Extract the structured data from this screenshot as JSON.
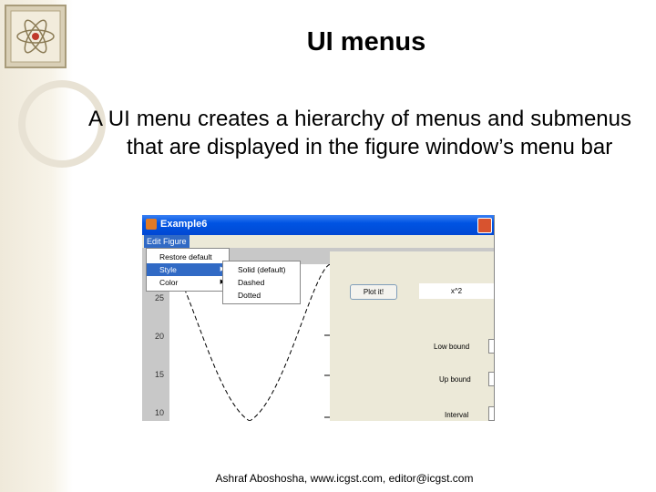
{
  "slide": {
    "title": "UI menus",
    "bullet": "A UI menu creates a hierarchy of menus and submenus that are displayed in the figure window’s menu bar",
    "footer": "Ashraf Aboshosha, www.icgst.com, editor@icgst.com"
  },
  "window": {
    "title": "Example6",
    "menubar": [
      "Edit Figure"
    ],
    "dropdown": [
      {
        "label": "Restore default",
        "has_submenu": false,
        "selected": false
      },
      {
        "label": "Style",
        "has_submenu": true,
        "selected": true
      },
      {
        "label": "Color",
        "has_submenu": true,
        "selected": false
      }
    ],
    "submenu": [
      "Solid (default)",
      "Dashed",
      "Dotted"
    ],
    "plot_button": "Plot it!",
    "function_field": "x^2",
    "labels": {
      "low": "Low bound",
      "up": "Up bound",
      "interval": "Interval"
    },
    "y_ticks": [
      "25",
      "20",
      "15",
      "10"
    ]
  },
  "colors": {
    "titlebar": "#0054e3",
    "menu_highlight": "#316ac5",
    "window_bg": "#ece9d8"
  },
  "icons": [
    "atom-logo-icon",
    "close-icon",
    "submenu-arrow-icon"
  ]
}
